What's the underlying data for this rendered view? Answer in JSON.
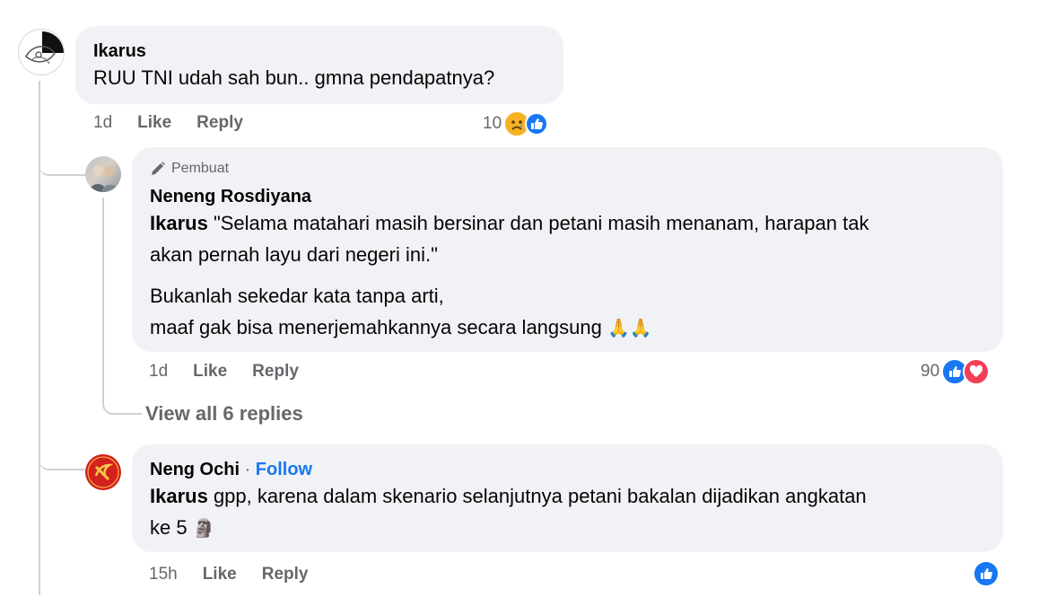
{
  "comment1": {
    "author": "Ikarus",
    "text": "RUU TNI udah sah bun.. gmna pendapatnya?",
    "time": "1d",
    "like_label": "Like",
    "reply_label": "Reply",
    "reaction_count": "10",
    "reaction_icons": [
      "sad-emoji-icon",
      "like-icon"
    ]
  },
  "reply1": {
    "badge": "Pembuat",
    "badge_icon": "pen-icon",
    "author": "Neneng Rosdiyana",
    "mention": "Ikarus",
    "line1": " \"Selama matahari masih bersinar dan petani masih menanam, harapan tak",
    "line2": "akan pernah layu dari negeri ini.\"",
    "line3": "Bukanlah sekedar kata tanpa arti,",
    "line4": "maaf gak bisa menerjemahkannya secara langsung",
    "emoji": "🙏🙏",
    "time": "1d",
    "like_label": "Like",
    "reply_label": "Reply",
    "reaction_count": "90",
    "reaction_icons": [
      "like-icon",
      "love-icon"
    ]
  },
  "view_all": "View all 6 replies",
  "reply2": {
    "author": "Neng Ochi",
    "separator": " · ",
    "follow_label": "Follow",
    "mention": "Ikarus",
    "line1": " gpp, karena dalam skenario selanjutnya petani bakalan dijadikan angkatan",
    "line2": "ke 5",
    "emoji": "🗿",
    "time": "15h",
    "like_label": "Like",
    "reply_label": "Reply",
    "reaction_icons": [
      "like-icon"
    ]
  },
  "colors": {
    "bubble": "#f0f2f5",
    "meta": "#65676b",
    "link": "#1877f2",
    "like": "#1877f2",
    "love": "#f33e58"
  }
}
